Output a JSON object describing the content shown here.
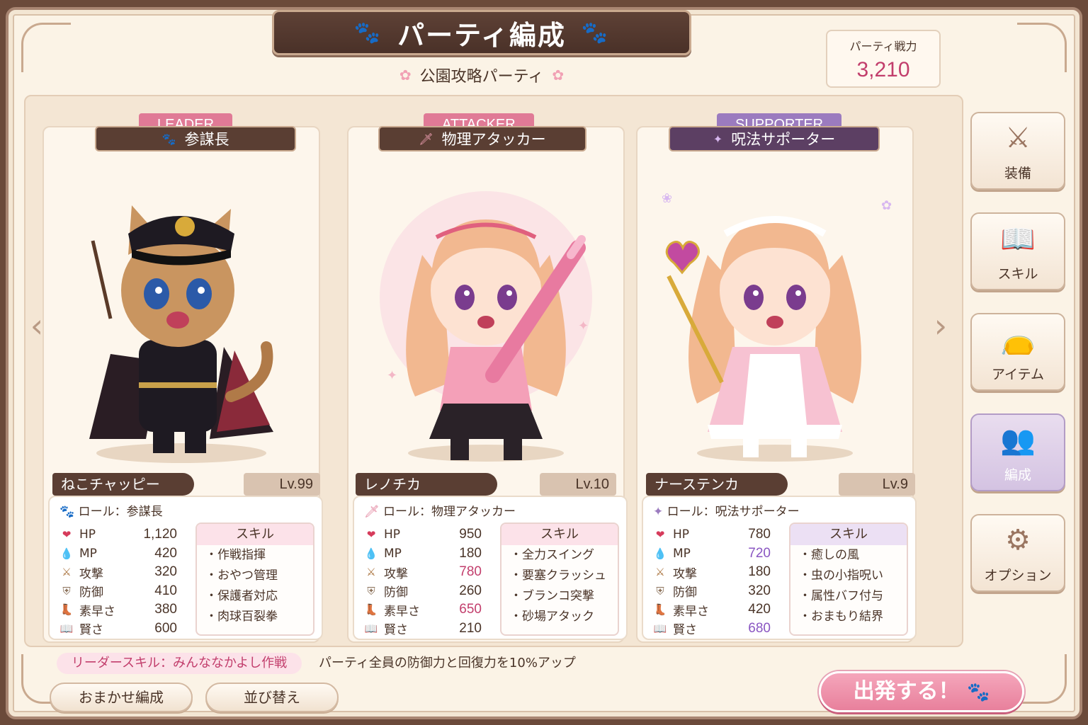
{
  "title": "パーティ編成",
  "party_name": "公園攻略パーティ",
  "power": {
    "label": "パーティ戦力",
    "value": "3,210"
  },
  "members": [
    {
      "role_tag": "LEADER",
      "role_title": "参謀長",
      "name": "ねこチャッピー",
      "level": "Lv.99",
      "role_line": "ロール：参謀長",
      "stats": [
        {
          "label": "HP",
          "value": "1,120"
        },
        {
          "label": "MP",
          "value": "420"
        },
        {
          "label": "攻撃",
          "value": "320"
        },
        {
          "label": "防御",
          "value": "410"
        },
        {
          "label": "素早さ",
          "value": "380"
        },
        {
          "label": "賢さ",
          "value": "600"
        }
      ],
      "skills_title": "スキル",
      "skills": [
        "・作戦指揮",
        "・おやつ管理",
        "・保護者対応",
        "・肉球百裂拳"
      ]
    },
    {
      "role_tag": "ATTACKER",
      "role_title": "物理アタッカー",
      "name": "レノチカ",
      "level": "Lv.10",
      "role_line": "ロール：物理アタッカー",
      "stats": [
        {
          "label": "HP",
          "value": "950"
        },
        {
          "label": "MP",
          "value": "180"
        },
        {
          "label": "攻撃",
          "value": "780"
        },
        {
          "label": "防御",
          "value": "260"
        },
        {
          "label": "素早さ",
          "value": "650"
        },
        {
          "label": "賢さ",
          "value": "210"
        }
      ],
      "skills_title": "スキル",
      "skills": [
        "・全力スイング",
        "・要塞クラッシュ",
        "・ブランコ突撃",
        "・砂場アタック"
      ]
    },
    {
      "role_tag": "SUPPORTER",
      "role_title": "呪法サポーター",
      "name": "ナーステンカ",
      "level": "Lv.9",
      "role_line": "ロール：呪法サポーター",
      "stats": [
        {
          "label": "HP",
          "value": "780"
        },
        {
          "label": "MP",
          "value": "720"
        },
        {
          "label": "攻撃",
          "value": "180"
        },
        {
          "label": "防御",
          "value": "320"
        },
        {
          "label": "素早さ",
          "value": "420"
        },
        {
          "label": "賢さ",
          "value": "680"
        }
      ],
      "skills_title": "スキル",
      "skills": [
        "・癒しの風",
        "・虫の小指呪い",
        "・属性バフ付与",
        "・おまもり結界"
      ]
    }
  ],
  "leader_skill": {
    "label": "リーダースキル：みんななかよし作戦",
    "description": "パーティ全員の防御力と回復力を10%アップ"
  },
  "buttons": {
    "auto": "おまかせ編成",
    "sort": "並び替え",
    "depart": "出発する！"
  },
  "side_menu": [
    {
      "label": "装備",
      "icon": "sword-shield-icon"
    },
    {
      "label": "スキル",
      "icon": "spellbook-icon"
    },
    {
      "label": "アイテム",
      "icon": "item-bag-icon"
    },
    {
      "label": "編成",
      "icon": "party-icon",
      "active": true
    },
    {
      "label": "オプション",
      "icon": "gear-icon"
    }
  ],
  "colors": {
    "leader": "#e07a96",
    "attacker": "#e07a96",
    "supporter": "#9b7bbf",
    "accent_pink": "#c23e6c",
    "accent_purple": "#8a56c2",
    "brown": "#5a3e33"
  }
}
